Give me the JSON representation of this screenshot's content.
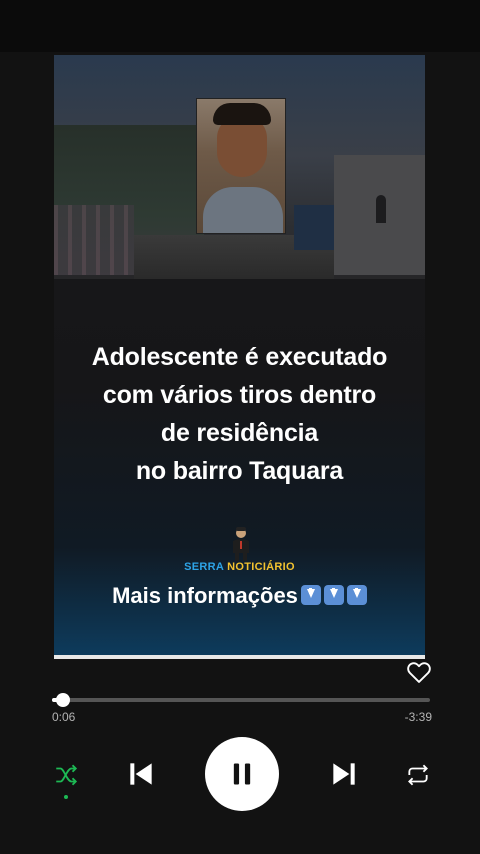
{
  "video": {
    "headline_lines": [
      "Adolescente é executado",
      "com vários tiros dentro",
      "de residência",
      "no bairro Taquara"
    ],
    "brand_part1": "SERRA",
    "brand_part2": "NOTICIÁRIO",
    "more_info": "Mais informações"
  },
  "player": {
    "current_time": "0:06",
    "remaining_time": "-3:39",
    "progress": 0.03,
    "state": "playing",
    "shuffle_active": true
  },
  "icons": {
    "like": "heart-outline-icon",
    "shuffle": "shuffle-icon",
    "previous": "skip-previous-icon",
    "pause": "pause-icon",
    "next": "skip-next-icon",
    "repeat": "repeat-icon",
    "arrows": "down-arrow-emoji"
  },
  "colors": {
    "accent_green": "#1db954",
    "brand_blue": "#2ea3e6",
    "brand_yellow": "#f2c230"
  }
}
